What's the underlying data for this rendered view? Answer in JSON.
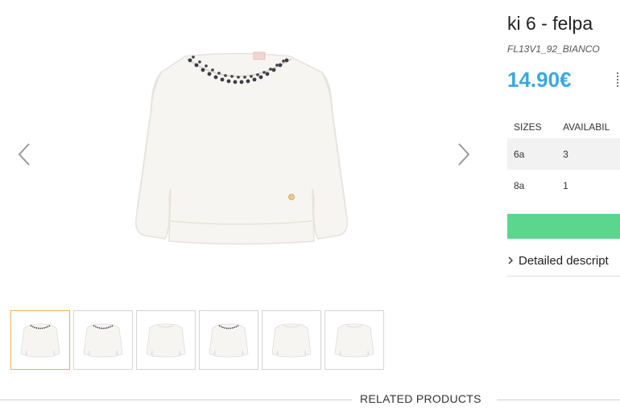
{
  "product": {
    "title": "ki 6 - felpa",
    "sku": "FL13V1_92_BIANCO",
    "price": "14.90€"
  },
  "gallery": {
    "prev_icon": "chevron-left-icon",
    "next_icon": "chevron-right-icon",
    "thumbnail_count": 6,
    "active_thumbnail": 0
  },
  "availability": {
    "headers": [
      "SIZES",
      "AVAILABIL"
    ],
    "rows": [
      {
        "size": "6a",
        "qty": "3"
      },
      {
        "size": "8a",
        "qty": "1"
      }
    ]
  },
  "buy_button": {
    "label": "",
    "color": "#5cd68f"
  },
  "details": {
    "label": "Detailed descript",
    "icon": "chevron-right-icon"
  },
  "related": {
    "label": "RELATED PRODUCTS"
  },
  "colors": {
    "price": "#3aa8e0",
    "active_thumb_border": "#f0ad4e",
    "button": "#5cd68f"
  }
}
